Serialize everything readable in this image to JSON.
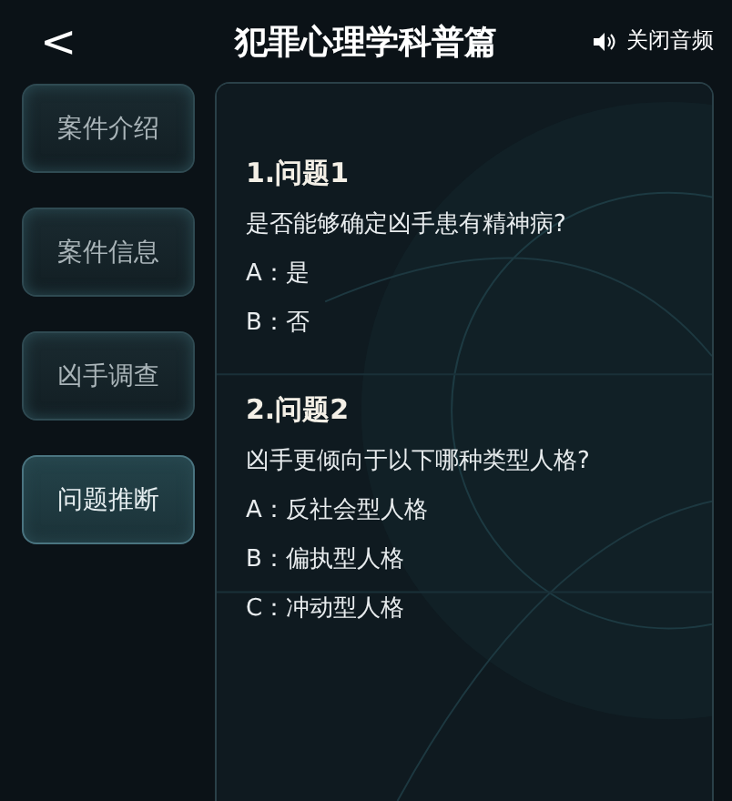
{
  "header": {
    "back": "<",
    "title": "犯罪心理学科普篇",
    "audio_label": "关闭音频"
  },
  "tabs": [
    {
      "label": "案件介绍",
      "selected": false
    },
    {
      "label": "案件信息",
      "selected": false
    },
    {
      "label": "凶手调查",
      "selected": false
    },
    {
      "label": "问题推断",
      "selected": true
    }
  ],
  "questions": [
    {
      "title": "1.问题1",
      "prompt": "是否能够确定凶手患有精神病?",
      "options": [
        "A：是",
        "B：否"
      ]
    },
    {
      "title": "2.问题2",
      "prompt": "凶手更倾向于以下哪种类型人格?",
      "options": [
        "A：反社会型人格",
        "B：偏执型人格",
        "C：冲动型人格"
      ]
    }
  ]
}
